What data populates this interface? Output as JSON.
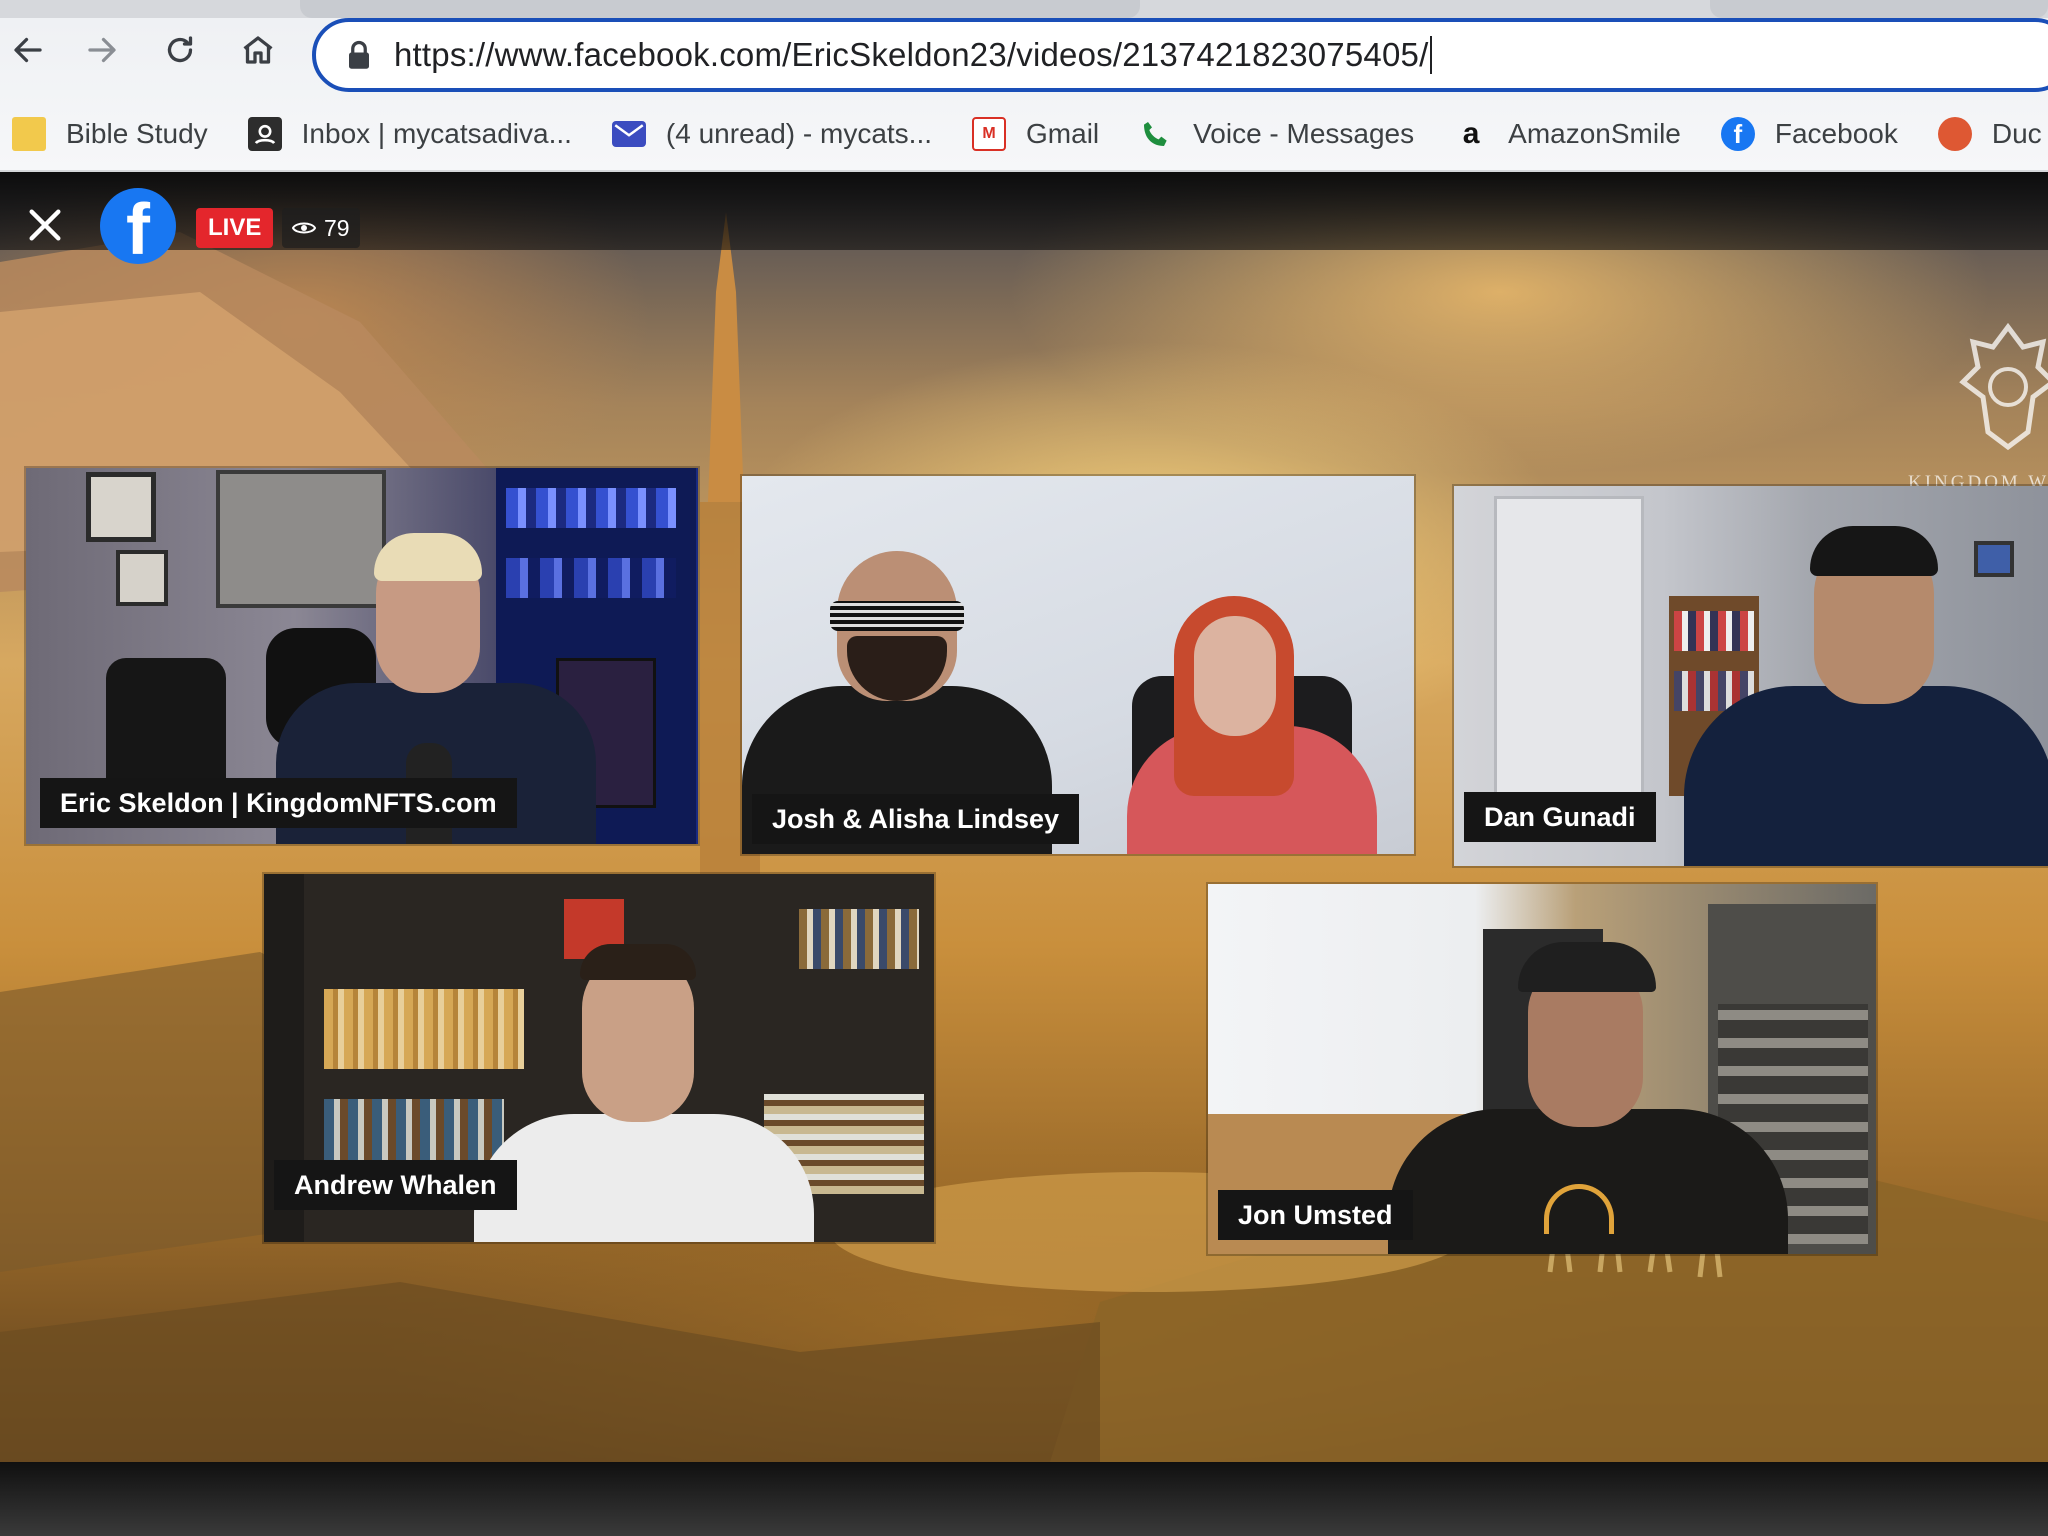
{
  "browser": {
    "url": "https://www.facebook.com/EricSkeldon23/videos/2137421823075405/",
    "nav": {
      "back_icon": "arrow-left-icon",
      "forward_icon": "arrow-right-icon",
      "reload_icon": "reload-icon",
      "home_icon": "home-icon"
    },
    "bookmarks": [
      {
        "label": "Bible Study",
        "icon": "folder-icon",
        "color": "#f2c94c"
      },
      {
        "label": "Inbox | mycatsadiva...",
        "icon": "mail-app-icon",
        "color": "#2d2d2d"
      },
      {
        "label": "(4 unread) - mycats...",
        "icon": "envelope-icon",
        "color": "#3b4cc0"
      },
      {
        "label": "Gmail",
        "icon": "gmail-icon",
        "color": "#d93025"
      },
      {
        "label": "Voice - Messages",
        "icon": "phone-icon",
        "color": "#1e8e3e"
      },
      {
        "label": "AmazonSmile",
        "icon": "amazon-icon",
        "color": "#111111"
      },
      {
        "label": "Facebook",
        "icon": "facebook-icon",
        "color": "#1877f2"
      },
      {
        "label": "Duc",
        "icon": "duckduckgo-icon",
        "color": "#de5833"
      }
    ]
  },
  "live": {
    "badge": "LIVE",
    "viewer_count": "79",
    "brand_text": "KINGDOM W",
    "participants": [
      {
        "name": "Eric Skeldon | KingdomNFTS.com"
      },
      {
        "name": "Josh & Alisha Lindsey"
      },
      {
        "name": "Dan Gunadi"
      },
      {
        "name": "Andrew Whalen"
      },
      {
        "name": "Jon Umsted"
      }
    ]
  },
  "colors": {
    "live_red": "#e4262c",
    "facebook_blue": "#1877f2",
    "omnibox_border": "#1a4fb8",
    "nameplate_bg": "#151515"
  }
}
